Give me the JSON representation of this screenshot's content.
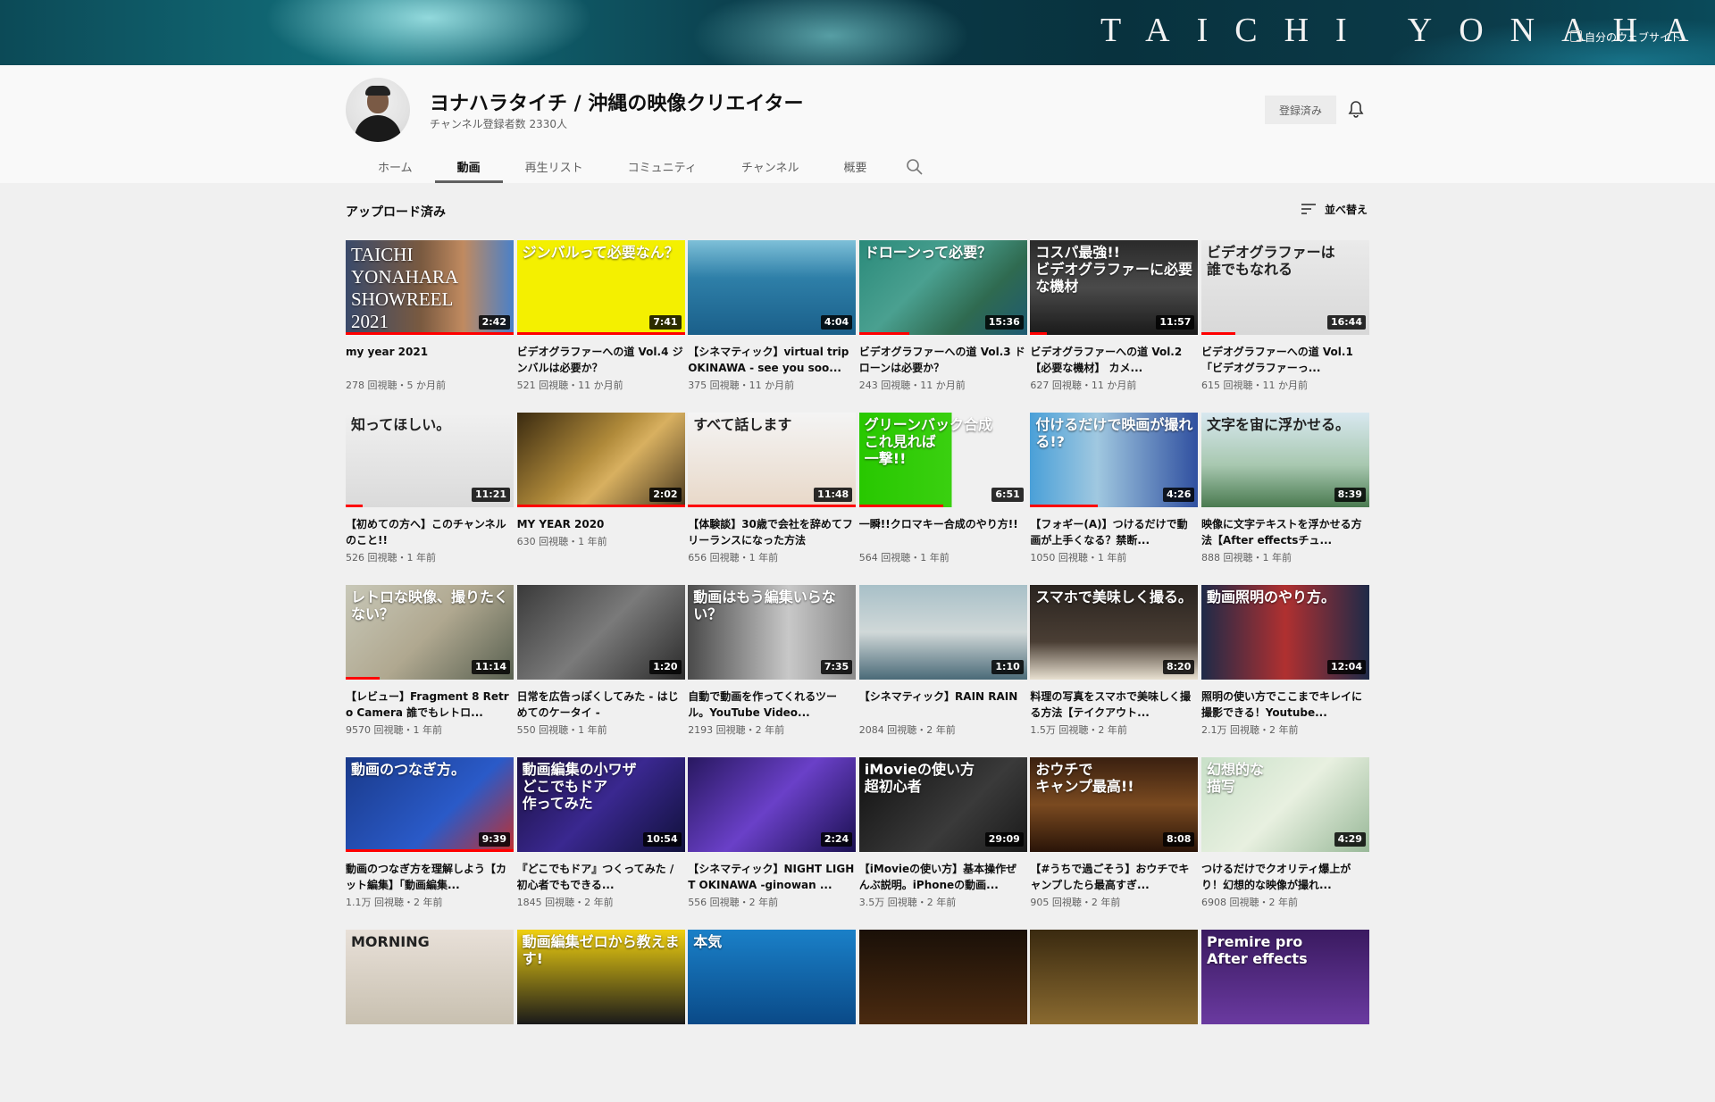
{
  "banner": {
    "title": "TAICHI  YONAHARA",
    "link": "自分のウェブサイト"
  },
  "channel": {
    "name": "ヨナハラタイチ / 沖縄の映像クリエイター",
    "subscribers": "チャンネル登録者数 2330人",
    "subscribe_label": "登録済み"
  },
  "tabs": [
    {
      "label": "ホーム"
    },
    {
      "label": "動画"
    },
    {
      "label": "再生リスト"
    },
    {
      "label": "コミュニティ"
    },
    {
      "label": "チャンネル"
    },
    {
      "label": "概要"
    }
  ],
  "section": {
    "title": "アップロード済み",
    "sort_label": "並べ替え"
  },
  "videos": [
    {
      "title": "my year 2021",
      "meta": "278 回視聴・5 か月前",
      "duration": "2:42",
      "thumb_text": "TAICHI\nYONAHARA\nSHOWREEL\n2021",
      "progress": 1.0,
      "bg": "linear-gradient(90deg,#3a4a6a 0%,#7a5a40 45%,#c08a60 70%,#4a80c8 100%)"
    },
    {
      "title": "ビデオグラファーへの道 Vol.4 ジンバルは必要か？",
      "meta": "521 回視聴・11 か月前",
      "duration": "7:41",
      "thumb_text": "ジンバルって必要なん？",
      "progress": 1.0,
      "bg": "#f4f000"
    },
    {
      "title": "【シネマティック】virtual trip OKINAWA - see you soo...",
      "meta": "375 回視聴・11 か月前",
      "duration": "4:04",
      "thumb_text": "",
      "progress": 0,
      "bg": "linear-gradient(180deg,#7ec0d8 0%,#2e7fa8 40%,#1a5f8a 100%)"
    },
    {
      "title": "ビデオグラファーへの道 Vol.3 ドローンは必要か？",
      "meta": "243 回視聴・11 か月前",
      "duration": "15:36",
      "thumb_text": "ドローンって必要？",
      "progress": 0.3,
      "bg": "linear-gradient(135deg,#2a8a7a 0%,#4aa090 40%,#2f6a50 70%,#1e5a72 100%)"
    },
    {
      "title": "ビデオグラファーへの道 Vol.2 【必要な機材】 カメ...",
      "meta": "627 回視聴・11 か月前",
      "duration": "11:57",
      "thumb_text": "コスパ最強!!\nビデオグラファーに必要な機材",
      "progress": 0.1,
      "bg": "linear-gradient(180deg,#2a2a2a 0%,#4a4a4a 50%,#1a1a1a 100%)"
    },
    {
      "title": "ビデオグラファーへの道 Vol.1「ビデオグラファーっ...",
      "meta": "615 回視聴・11 か月前",
      "duration": "16:44",
      "thumb_text": "ビデオグラファーは\n誰でもなれる",
      "progress": 0.2,
      "bg": "linear-gradient(180deg,#eaeaea 0%,#d8d8d8 100%)",
      "dark": true
    },
    {
      "title": "【初めての方へ】このチャンネルのこと!!",
      "meta": "526 回視聴・1 年前",
      "duration": "11:21",
      "thumb_text": "知ってほしい。",
      "progress": 0.1,
      "bg": "linear-gradient(180deg,#f0f0f0 0%,#dadada 100%)",
      "dark": true
    },
    {
      "title": "MY YEAR 2020",
      "meta": "630 回視聴・1 年前",
      "duration": "2:02",
      "thumb_text": "",
      "progress": 1.0,
      "bg": "linear-gradient(135deg,#3a2a10 0%,#b08a3a 45%,#d8b060 60%,#4a3a20 100%)",
      "one_line": true
    },
    {
      "title": "【体験談】30歳で会社を辞めてフリーランスになった方法",
      "meta": "656 回視聴・1 年前",
      "duration": "11:48",
      "thumb_text": "すべて話します",
      "progress": 1.0,
      "bg": "linear-gradient(180deg,#f4f4f4 0%,#e8d8c8 100%)",
      "dark": true
    },
    {
      "title": "一瞬!!クロマキー合成のやり方!!",
      "meta": "564 回視聴・1 年前",
      "duration": "6:51",
      "thumb_text": "グリーンバック合成\nこれ見れば\n一撃!!",
      "progress": 0.5,
      "bg": "linear-gradient(90deg,#28c800 0%,#3ad010 55%,#f0f0f0 55%,#f0f0f0 100%)"
    },
    {
      "title": "【フォギー(A)】つけるだけで動画が上手くなる？禁断...",
      "meta": "1050 回視聴・1 年前",
      "duration": "4:26",
      "thumb_text": "付けるだけで映画が撮れる!?",
      "progress": 0.4,
      "bg": "linear-gradient(90deg,#4aa0d8 0%,#a0c8e0 40%,#3050a0 100%)"
    },
    {
      "title": "映像に文字テキストを浮かせる方法【After effectsチュ...",
      "meta": "888 回視聴・1 年前",
      "duration": "8:39",
      "thumb_text": "文字を宙に浮かせる。",
      "progress": 0,
      "bg": "linear-gradient(180deg,#d8e8f0 0%,#a8c8b0 55%,#4a7a50 100%)",
      "dark": true
    },
    {
      "title": "【レビュー】Fragment 8 Retro Camera 誰でもレトロ...",
      "meta": "9570 回視聴・1 年前",
      "duration": "11:14",
      "thumb_text": "レトロな映像、撮りたくない？",
      "progress": 0.2,
      "bg": "linear-gradient(135deg,#c8c8b8 0%,#b0a890 50%,#586050 100%)"
    },
    {
      "title": "日常を広告っぽくしてみた - はじめてのケータイ -",
      "meta": "550 回視聴・1 年前",
      "duration": "1:20",
      "thumb_text": "",
      "progress": 0,
      "bg": "linear-gradient(135deg,#3a3a3a 0%,#7a7a7a 50%,#2a2a2a 100%)"
    },
    {
      "title": "自動で動画を作ってくれるツール。YouTube Video...",
      "meta": "2193 回視聴・2 年前",
      "duration": "7:35",
      "thumb_text": "動画はもう編集いらない？",
      "progress": 0,
      "bg": "linear-gradient(90deg,#4a4a4a 0%,#c8c8c8 60%,#8a8a8a 100%)"
    },
    {
      "title": "【シネマティック】RAIN RAIN",
      "meta": "2084 回視聴・2 年前",
      "duration": "1:10",
      "thumb_text": "",
      "progress": 0,
      "bg": "linear-gradient(180deg,#a8c0c8 0%,#d0d8d8 50%,#4a6a78 100%)"
    },
    {
      "title": "料理の写真をスマホで美味しく撮る方法【テイクアウト...",
      "meta": "1.5万 回視聴・2 年前",
      "duration": "8:20",
      "thumb_text": "スマホで美味しく撮る。",
      "progress": 0,
      "bg": "linear-gradient(180deg,#2a2420 0%,#4a3e34 60%,#e8e0d0 100%)"
    },
    {
      "title": "照明の使い方でここまでキレイに撮影できる！Youtube...",
      "meta": "2.1万 回視聴・2 年前",
      "duration": "12:04",
      "thumb_text": "動画照明のやり方。",
      "progress": 0,
      "bg": "linear-gradient(90deg,#1e2a48 0%,#b03030 50%,#1e2a48 100%)"
    },
    {
      "title": "動画のつなぎ方を理解しよう【カット編集】「動画編集...",
      "meta": "1.1万 回視聴・2 年前",
      "duration": "9:39",
      "thumb_text": "動画のつなぎ方。",
      "progress": 1.0,
      "bg": "linear-gradient(135deg,#1a3a8a 0%,#2a5ac8 60%,#c03030 100%)"
    },
    {
      "title": "『どこでもドア』つくってみた / 初心者でもできる...",
      "meta": "1845 回視聴・2 年前",
      "duration": "10:54",
      "thumb_text": "動画編集の小ワザ\nどこでもドア\n作ってみた",
      "progress": 0,
      "bg": "linear-gradient(135deg,#1a1040 0%,#3a2890 50%,#10103a 100%)"
    },
    {
      "title": "【シネマティック】NIGHT LIGHT OKINAWA -ginowan ...",
      "meta": "556 回視聴・2 年前",
      "duration": "2:24",
      "thumb_text": "",
      "progress": 0,
      "bg": "linear-gradient(135deg,#281860 0%,#6a40c8 50%,#1a1050 100%)"
    },
    {
      "title": "【iMovieの使い方】基本操作ぜんぶ説明。iPhoneの動画...",
      "meta": "3.5万 回視聴・2 年前",
      "duration": "29:09",
      "thumb_text": "iMovieの使い方\n超初心者",
      "progress": 0,
      "bg": "linear-gradient(135deg,#101010 0%,#3a3a3a 60%,#1a1a1a 100%)"
    },
    {
      "title": "【#うちで過ごそう】おウチでキャンプしたら最高すぎ...",
      "meta": "905 回視聴・2 年前",
      "duration": "8:08",
      "thumb_text": "おウチで\nキャンプ最高!!",
      "progress": 0,
      "bg": "linear-gradient(180deg,#3a2010 0%,#7a4a20 50%,#2a1408 100%)"
    },
    {
      "title": "つけるだけでクオリティ爆上がり！幻想的な映像が撮れ...",
      "meta": "6908 回視聴・2 年前",
      "duration": "4:29",
      "thumb_text": "幻想的な\n描写",
      "progress": 0,
      "bg": "linear-gradient(135deg,#c8e0c8 0%,#e8f0e0 50%,#98b898 100%)"
    },
    {
      "title": "",
      "meta": "",
      "duration": "",
      "thumb_text": "MORNING",
      "progress": 0,
      "bg": "linear-gradient(180deg,#e8e0d8 0%,#c8c0b0 100%)",
      "dark": true
    },
    {
      "title": "",
      "meta": "",
      "duration": "",
      "thumb_text": "動画編集ゼロから教えます!",
      "progress": 0,
      "bg": "linear-gradient(180deg,#f0d010 0%,#1a1a1a 100%)"
    },
    {
      "title": "",
      "meta": "",
      "duration": "",
      "thumb_text": "本気",
      "progress": 0,
      "bg": "linear-gradient(180deg,#1a80c8 0%,#0a4a88 100%)"
    },
    {
      "title": "",
      "meta": "",
      "duration": "",
      "thumb_text": "",
      "progress": 0,
      "bg": "linear-gradient(180deg,#1a1008 0%,#4a2a10 100%)"
    },
    {
      "title": "",
      "meta": "",
      "duration": "",
      "thumb_text": "",
      "progress": 0,
      "bg": "linear-gradient(180deg,#3a2a10 0%,#8a6a30 100%)"
    },
    {
      "title": "",
      "meta": "",
      "duration": "",
      "thumb_text": "Premire pro\nAfter effects",
      "progress": 0,
      "bg": "linear-gradient(180deg,#3a1a60 0%,#6a3aa0 100%)"
    }
  ]
}
